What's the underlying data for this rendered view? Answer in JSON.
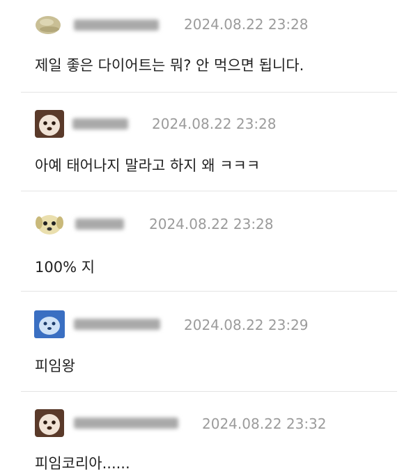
{
  "comments": [
    {
      "avatar": "blob-avatar-icon",
      "timestamp": "2024.08.22 23:28",
      "text": "제일 좋은 다이어트는 뭐? 안 먹으면 됩니다."
    },
    {
      "avatar": "dog-face-avatar-icon",
      "timestamp": "2024.08.22 23:28",
      "text": "아예 태어나지 말라고 하지 왜 ㅋㅋㅋ"
    },
    {
      "avatar": "puppy-avatar-icon",
      "timestamp": "2024.08.22 23:28",
      "text": "100% 지"
    },
    {
      "avatar": "blue-dog-avatar-icon",
      "timestamp": "2024.08.22 23:29",
      "text": "피임왕"
    },
    {
      "avatar": "dog-face-avatar-icon",
      "timestamp": "2024.08.22 23:32",
      "text": "피임코리아......"
    }
  ],
  "colors": {
    "timestamp": "#9b9b9b",
    "divider": "#e4e4e4",
    "text": "#1f1f1f",
    "nickname_blur": "#a9a9a9"
  }
}
